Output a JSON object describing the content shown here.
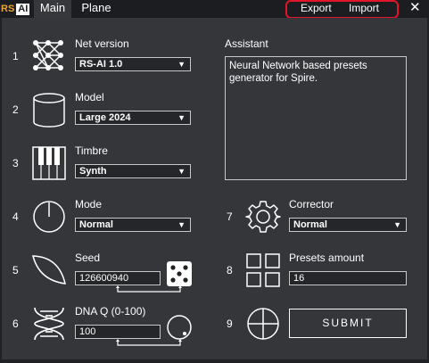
{
  "header": {
    "logo_rs": "RS",
    "logo_ai": "AI",
    "tabs": [
      "Main",
      "Plane"
    ],
    "export_label": "Export",
    "import_label": "Import",
    "close_glyph": "✕"
  },
  "steps": {
    "s1": "1",
    "s2": "2",
    "s3": "3",
    "s4": "4",
    "s5": "5",
    "s6": "6",
    "s7": "7",
    "s8": "8",
    "s9": "9"
  },
  "net_version": {
    "label": "Net version",
    "value": "RS-AI 1.0"
  },
  "model": {
    "label": "Model",
    "value": "Large 2024"
  },
  "timbre": {
    "label": "Timbre",
    "value": "Synth"
  },
  "mode": {
    "label": "Mode",
    "value": "Normal"
  },
  "seed": {
    "label": "Seed",
    "value": "126600940"
  },
  "dna": {
    "label": "DNA Q (0-100)",
    "value": "100"
  },
  "assistant": {
    "label": "Assistant",
    "text": "Neural Network based presets generator for Spire."
  },
  "corrector": {
    "label": "Corrector",
    "value": "Normal"
  },
  "presets": {
    "label": "Presets amount",
    "value": "16"
  },
  "submit_label": "SUBMIT",
  "colors": {
    "panel": "#34363a",
    "background": "#1f2124",
    "highlight": "#e0152a",
    "logo_accent": "#e8a33a"
  },
  "icons": {
    "net_version": "neural-network-icon",
    "model": "database-cylinder-icon",
    "timbre": "piano-keys-icon",
    "mode": "dial-knob-icon",
    "seed": "leaf-icon",
    "seed_random": "dice-icon",
    "dna": "dna-helix-icon",
    "dna_knob": "knob-icon",
    "corrector": "gear-icon",
    "presets": "grid-squares-icon",
    "submit": "plus-circle-icon"
  }
}
